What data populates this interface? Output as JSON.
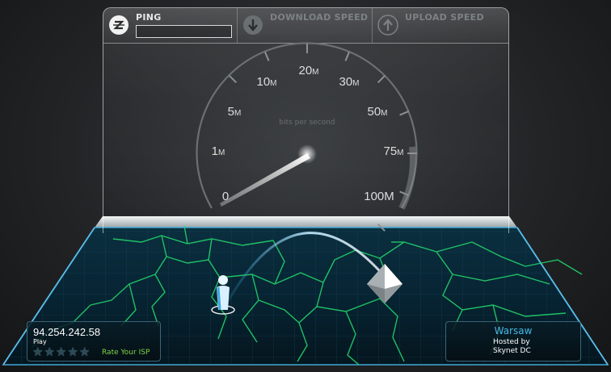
{
  "header": {
    "ping": {
      "label": "PING",
      "value": "",
      "icon": "ping-icon"
    },
    "download": {
      "label": "DOWNLOAD SPEED",
      "icon": "arrow-down-icon"
    },
    "upload": {
      "label": "UPLOAD SPEED",
      "icon": "arrow-up-icon"
    }
  },
  "gauge": {
    "unit_caption": "bits per second",
    "ticks": [
      {
        "num": "0",
        "suffix": ""
      },
      {
        "num": "1",
        "suffix": "M"
      },
      {
        "num": "5",
        "suffix": "M"
      },
      {
        "num": "10",
        "suffix": "M"
      },
      {
        "num": "20",
        "suffix": "M"
      },
      {
        "num": "30",
        "suffix": "M"
      },
      {
        "num": "50",
        "suffix": "M"
      },
      {
        "num": "75",
        "suffix": "M"
      },
      {
        "num": "100M",
        "suffix": ""
      }
    ],
    "needle_value_mbps": 0
  },
  "client": {
    "ip": "94.254.242.58",
    "isp": "Play",
    "rating_stars": 5,
    "rating_filled": 0,
    "rate_label": "Rate Your ISP"
  },
  "server": {
    "city": "Warsaw",
    "hosted_label": "Hosted by",
    "host": "Skynet DC"
  },
  "colors": {
    "map_border_green": "#22d36b",
    "accent_blue": "#45b8e6",
    "rate_green": "#7fd644"
  }
}
